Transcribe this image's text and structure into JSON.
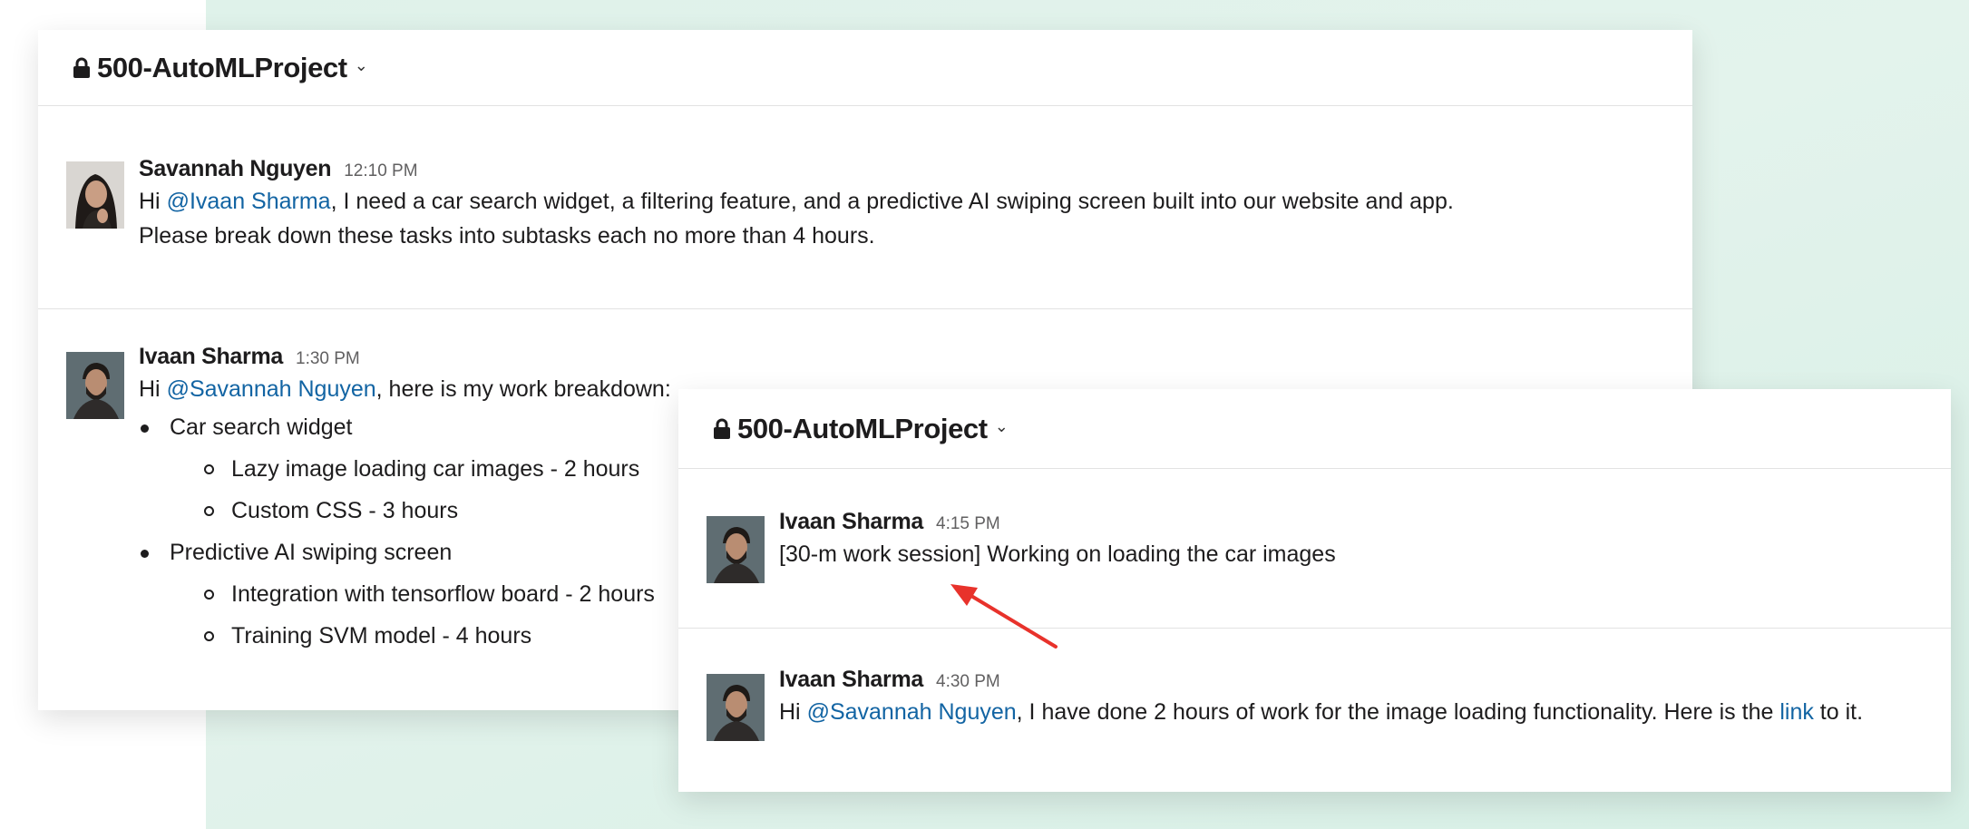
{
  "channel": {
    "name": "500-AutoMLProject"
  },
  "window1": {
    "messages": [
      {
        "author": "Savannah Nguyen",
        "time": "12:10 PM",
        "line1_prefix": "Hi ",
        "line1_mention": "@Ivaan Sharma",
        "line1_rest": ", I need a car search widget, a filtering feature, and a predictive AI swiping screen built into our website and app.",
        "line2": "Please break down these tasks into subtasks each no more than 4 hours."
      },
      {
        "author": "Ivaan Sharma",
        "time": "1:30 PM",
        "line1_prefix": "Hi ",
        "line1_mention": "@Savannah Nguyen",
        "line1_rest": ", here is my work breakdown:",
        "breakdown": [
          {
            "task": "Car search widget",
            "subtasks": [
              "Lazy image loading car images - 2 hours",
              "Custom CSS - 3 hours"
            ]
          },
          {
            "task": "Predictive AI swiping screen",
            "subtasks": [
              "Integration with tensorflow board - 2 hours",
              "Training SVM model - 4 hours"
            ]
          }
        ]
      }
    ]
  },
  "window2": {
    "messages": [
      {
        "author": "Ivaan Sharma",
        "time": "4:15 PM",
        "text": "[30-m work session] Working on loading the car images"
      },
      {
        "author": "Ivaan Sharma",
        "time": "4:30 PM",
        "prefix": "Hi ",
        "mention": "@Savannah Nguyen",
        "middle": ", I have done 2 hours of work for the image loading functionality. Here is the ",
        "link_text": "link",
        "suffix": " to it."
      }
    ]
  },
  "colors": {
    "mention": "#1264a3",
    "arrow": "#e8322b",
    "background": "#dff2ea"
  }
}
